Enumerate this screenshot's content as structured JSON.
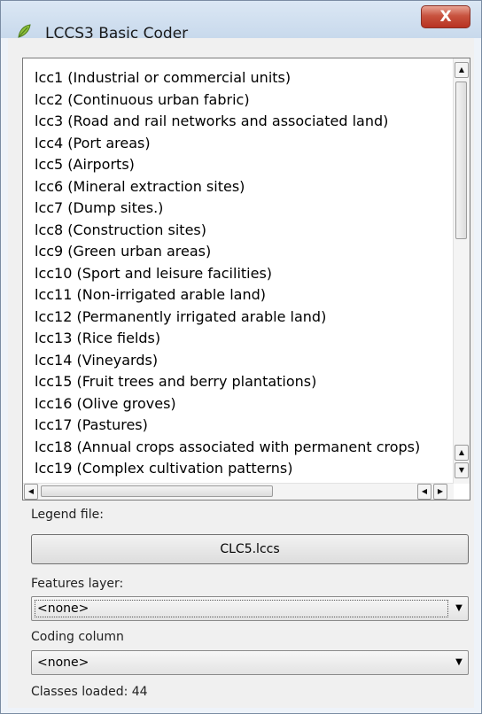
{
  "window": {
    "title": "LCCS3 Basic Coder",
    "close_label": "X"
  },
  "class_list": {
    "items": [
      "lcc1 (Industrial or commercial units)",
      "lcc2 (Continuous urban fabric)",
      "lcc3 (Road and rail networks and associated land)",
      "lcc4 (Port areas)",
      "lcc5 (Airports)",
      "lcc6 (Mineral extraction sites)",
      "lcc7 (Dump sites.)",
      "lcc8 (Construction sites)",
      "lcc9 (Green urban areas)",
      "lcc10 (Sport and leisure facilities)",
      "lcc11 (Non-irrigated arable land)",
      "lcc12 (Permanently irrigated arable land)",
      "lcc13 (Rice fields)",
      "lcc14 (Vineyards)",
      "lcc15 (Fruit trees and berry plantations)",
      "lcc16 (Olive groves)",
      "lcc17 (Pastures)",
      "lcc18 (Annual crops associated with permanent crops)",
      "lcc19 (Complex cultivation patterns)"
    ]
  },
  "legend": {
    "label": "Legend file:",
    "button_label": "CLC5.lccs"
  },
  "features": {
    "label": "Features layer:",
    "value": "<none>"
  },
  "coding": {
    "label": "Coding column",
    "value": "<none>"
  },
  "status": {
    "text": "Classes loaded: 44"
  },
  "icons": {
    "up": "▲",
    "down": "▼",
    "left": "◀",
    "right": "▶",
    "dropdown": "▼"
  },
  "colors": {
    "close_button": "#c8533f",
    "titlebar": "#c8d9ec"
  }
}
